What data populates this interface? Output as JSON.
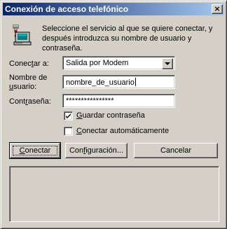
{
  "window": {
    "title": "Conexión de acceso telefónico",
    "close_glyph": "×"
  },
  "intro_text": "Seleccione el servicio al que se quiere conectar, y después introduzca su nombre de usuario y contraseña.",
  "icon": "dialup-computer-icon",
  "form": {
    "connect_to": {
      "label_prefix": "Conec",
      "label_mnemonic": "t",
      "label_suffix": "ar a:",
      "value": "Salida por Modem"
    },
    "username": {
      "label_line1": "Nombre de",
      "label_mnemonic": "u",
      "label_suffix": "suario:",
      "value": "nombre_de_usuario"
    },
    "password": {
      "label_prefix": "Cont",
      "label_mnemonic": "r",
      "label_suffix": "aseña:",
      "value": "****************"
    },
    "save_password": {
      "label_mnemonic": "G",
      "label_suffix": "uardar contraseña",
      "checked": true
    },
    "auto_connect": {
      "label_mnemonic": "C",
      "label_suffix": "onectar automáticamente",
      "checked": false
    }
  },
  "buttons": {
    "connect": {
      "mnemonic": "C",
      "suffix": "onectar"
    },
    "configuration": {
      "prefix": "Con",
      "mnemonic": "f",
      "suffix": "iguración..."
    },
    "cancel": "Cancelar"
  },
  "colors": {
    "face": "#d4d0c8",
    "title_start": "#0a246a",
    "title_end": "#a6caf0"
  }
}
